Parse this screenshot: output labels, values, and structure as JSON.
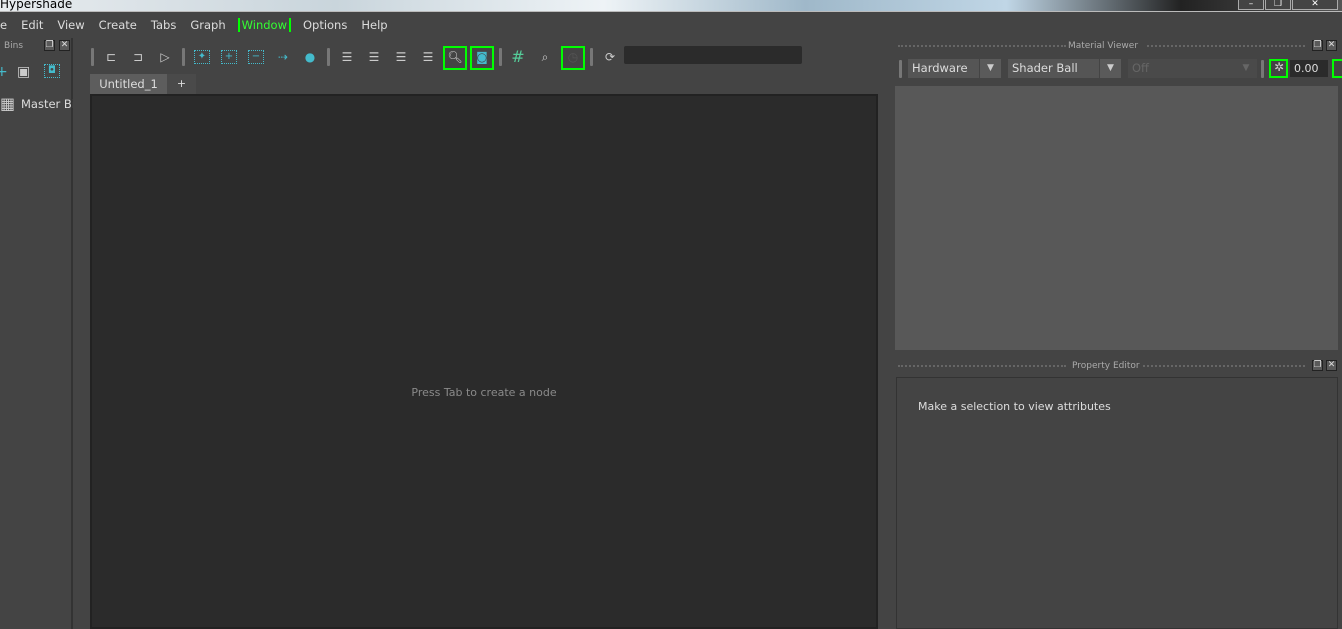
{
  "window": {
    "title": "Hypershade",
    "controls": [
      "–",
      "❐",
      "✕"
    ]
  },
  "menu": [
    "e",
    "Edit",
    "View",
    "Create",
    "Tabs",
    "Graph",
    "Window",
    "Options",
    "Help"
  ],
  "bins": {
    "title": "Bins",
    "master_bin": "Master Bin"
  },
  "tabs": [
    {
      "label": "Untitled_1"
    },
    {
      "label": "+"
    }
  ],
  "graph": {
    "hint": "Press Tab to create a node"
  },
  "material_viewer": {
    "title": "Material Viewer",
    "renderer": "Hardware",
    "geometry": "Shader Ball",
    "lighting": "Off",
    "exposure": "0.00"
  },
  "property_editor": {
    "title": "Property Editor",
    "message": "Make a selection to view attributes"
  },
  "colors": {
    "highlight": "#00ff00",
    "accent": "#44bbcc"
  }
}
